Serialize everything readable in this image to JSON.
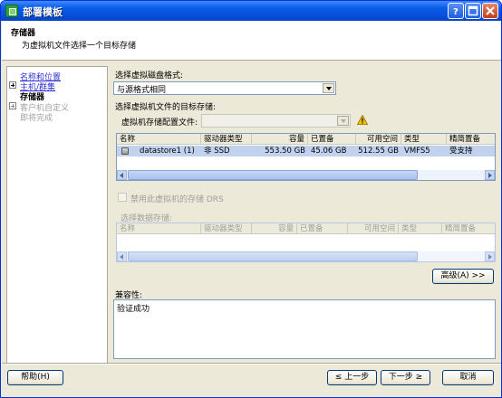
{
  "window": {
    "title": "部署模板"
  },
  "header": {
    "title": "存储器",
    "subtitle": "为虚拟机文件选择一个目标存储"
  },
  "nav": {
    "items": [
      {
        "label": "名称和位置",
        "state": "link"
      },
      {
        "label": "主机/群集",
        "state": "link"
      },
      {
        "label": "存储器",
        "state": "current"
      },
      {
        "label": "客户机自定义",
        "state": "disabled"
      },
      {
        "label": "即将完成",
        "state": "disabled"
      }
    ]
  },
  "disk_format": {
    "label": "选择虚拟磁盘格式:",
    "selected": "与源格式相同"
  },
  "target_storage": {
    "label": "选择虚拟机文件的目标存储:",
    "profile_label": "虚拟机存储配置文件:",
    "profile_value": ""
  },
  "datastore_table": {
    "columns": [
      "名称",
      "驱动器类型",
      "容量",
      "已置备",
      "可用空间",
      "类型",
      "精简置备"
    ],
    "rows": [
      [
        "datastore1 (1)",
        "非 SSD",
        "553.50 GB",
        "45.06 GB",
        "512.55 GB",
        "VMFS5",
        "受支持"
      ]
    ]
  },
  "drs_checkbox": {
    "label": "禁用此虚拟机的存储 DRS",
    "checked": false
  },
  "select_datastore": {
    "label": "选择数据存储:",
    "columns": [
      "名称",
      "驱动器类型",
      "容量",
      "已置备",
      "可用空间",
      "类型",
      "精简置备"
    ]
  },
  "advanced_button": "高级(A) >>",
  "compat": {
    "label": "兼容性:",
    "text": "验证成功"
  },
  "footer": {
    "help": "帮助(H)",
    "back": "≤ 上一步",
    "next": "下一步 ≥",
    "cancel": "取消"
  },
  "colors": {
    "titlebar": "#0550dc",
    "selected_row": "#c1d2ee",
    "link": "#2d2dd6",
    "face": "#ece9d8"
  }
}
